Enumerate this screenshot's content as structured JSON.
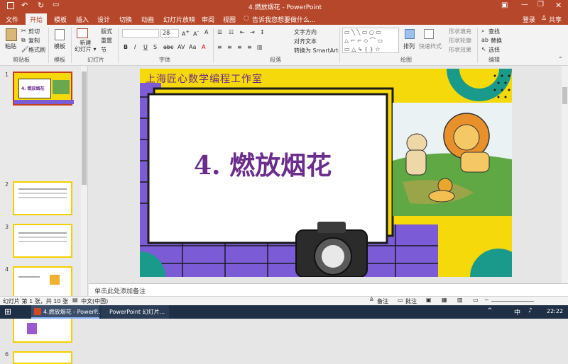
{
  "window": {
    "title": "4.燃放烟花 - PowerPoint"
  },
  "tabs": [
    "文件",
    "开始",
    "模板",
    "插入",
    "设计",
    "切换",
    "动画",
    "幻灯片放映",
    "审阅",
    "视图"
  ],
  "tell_me": "告诉我您想要做什么...",
  "login": "登录",
  "share": "共享",
  "ribbon": {
    "clipboard": {
      "paste": "粘贴",
      "cut": "剪切",
      "copy": "复制",
      "format_painter": "格式刷",
      "label": "剪贴板"
    },
    "template": {
      "item": "模板",
      "label": "模板"
    },
    "slides": {
      "new_slide": "新建\n幻灯片",
      "layout": "版式",
      "reset": "重置",
      "section": "节",
      "label": "幻灯片"
    },
    "font": {
      "size": "28",
      "label": "字体"
    },
    "paragraph": {
      "text_direction": "文字方向",
      "align_text": "对齐文本",
      "smartart": "转换为 SmartArt",
      "label": "段落"
    },
    "drawing": {
      "arrange": "排列",
      "quick_styles": "快速样式",
      "fill": "形状填充",
      "outline": "形状轮廓",
      "effects": "形状效果",
      "label": "绘图"
    },
    "editing": {
      "find": "查找",
      "replace": "替换",
      "select": "选择",
      "label": "编辑"
    }
  },
  "thumbnails": [
    "1",
    "2",
    "3",
    "4",
    "5",
    "6"
  ],
  "slide": {
    "header": "上海匠心数学编程工作室",
    "title": "4. 燃放烟花"
  },
  "notes_placeholder": "单击此处添加备注",
  "status": {
    "slide_info": "幻灯片 第 1 张，共 10 张",
    "language": "中文(中国)",
    "notes_btn": "备注",
    "comments_btn": "批注"
  },
  "taskbar": {
    "app1": "4.燃放烟花 - PowerP...",
    "app2": "PowerPoint 幻灯片...",
    "ime": "中",
    "time": "22:22"
  },
  "colors": {
    "accent": "#b7472a",
    "slide_yellow": "#f6d90a",
    "slide_purple": "#7b5bd6",
    "slide_teal": "#1a9a8a",
    "title_purple": "#6b2d8c"
  }
}
